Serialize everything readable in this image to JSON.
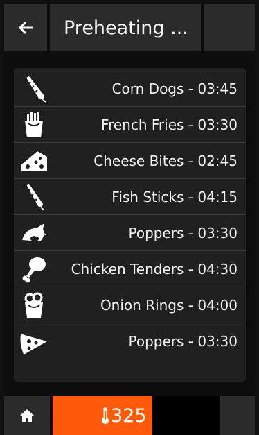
{
  "header": {
    "back_icon": "back-arrow-icon",
    "title": "Preheating ..."
  },
  "items": [
    {
      "label": "Corn Dogs - 03:45",
      "icon": "corn-dog-icon"
    },
    {
      "label": "French Fries - 03:30",
      "icon": "french-fries-icon"
    },
    {
      "label": "Cheese Bites - 02:45",
      "icon": "cheese-icon"
    },
    {
      "label": "Fish Sticks - 04:15",
      "icon": "fish-stick-icon"
    },
    {
      "label": "Poppers - 03:30",
      "icon": "popper-icon"
    },
    {
      "label": "Chicken Tenders - 04:30",
      "icon": "chicken-leg-icon"
    },
    {
      "label": "Onion Rings - 04:00",
      "icon": "onion-rings-icon"
    },
    {
      "label": "Poppers - 03:30",
      "icon": "pizza-slice-icon"
    }
  ],
  "footer": {
    "home_icon": "home-icon",
    "thermometer_icon": "thermometer-icon",
    "temperature": "325",
    "accent_color": "#ff5a0a"
  }
}
